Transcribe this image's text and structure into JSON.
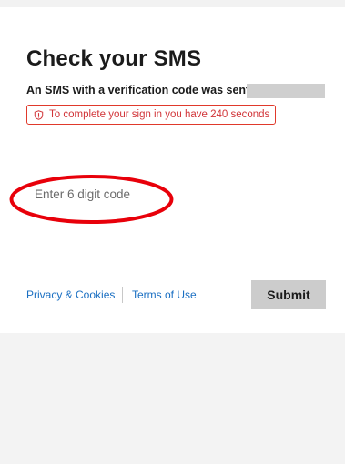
{
  "page": {
    "title": "Check your SMS",
    "subtitle": "An SMS with a verification code was sent to"
  },
  "alert": {
    "icon": "shield-icon",
    "message": "To complete your sign in you have 240 seconds",
    "color": "#d13438"
  },
  "code_input": {
    "placeholder": "Enter 6 digit code",
    "value": ""
  },
  "footer": {
    "privacy_label": "Privacy & Cookies",
    "terms_label": "Terms of Use"
  },
  "submit": {
    "label": "Submit",
    "background": "#cccccc"
  },
  "colors": {
    "link": "#1a6fc2",
    "annotation": "#e8000a"
  }
}
